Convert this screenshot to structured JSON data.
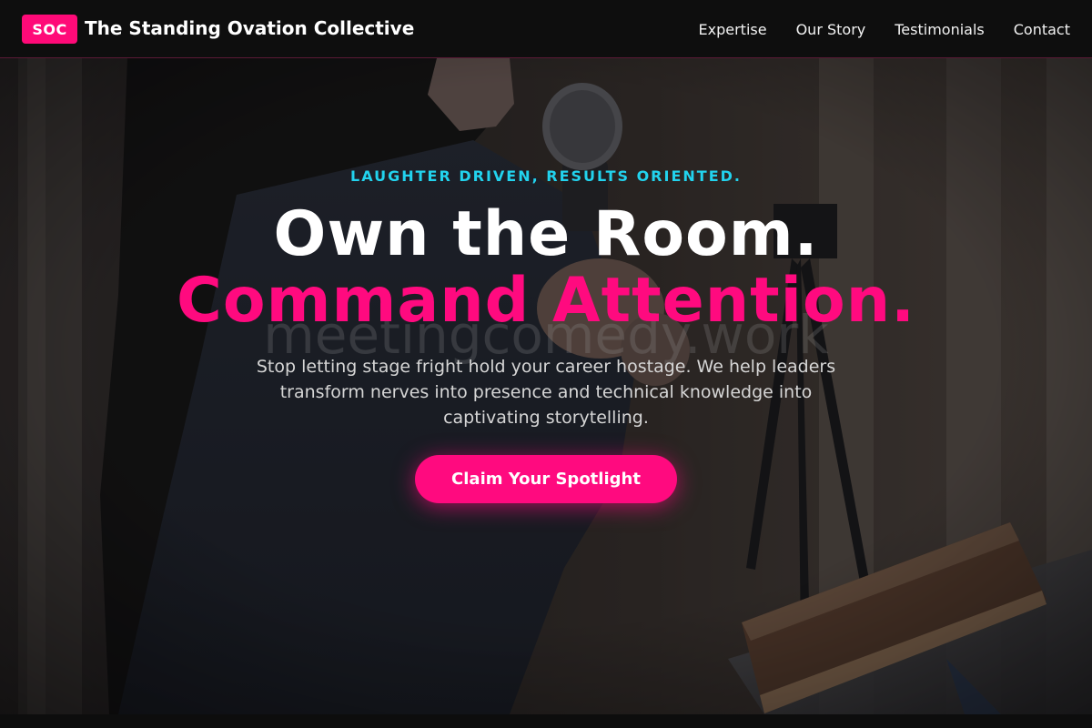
{
  "header": {
    "logo_badge": "SOC",
    "brand_name": "The Standing Ovation Collective",
    "nav": [
      "Expertise",
      "Our Story",
      "Testimonials",
      "Contact"
    ]
  },
  "hero": {
    "tagline": "LAUGHTER DRIVEN, RESULTS ORIENTED.",
    "headline_line1": "Own the Room.",
    "headline_line2": "Command Attention.",
    "watermark": "meetingcomedy.work",
    "subtext": "Stop letting stage fright hold your career hostage. We help leaders transform nerves into presence and technical knowledge into captivating storytelling.",
    "cta_label": "Claim Your Spotlight"
  },
  "colors": {
    "accent_pink": "#ff0a7f",
    "accent_cyan": "#22d3ee",
    "header_bg": "#0e0e0e"
  }
}
